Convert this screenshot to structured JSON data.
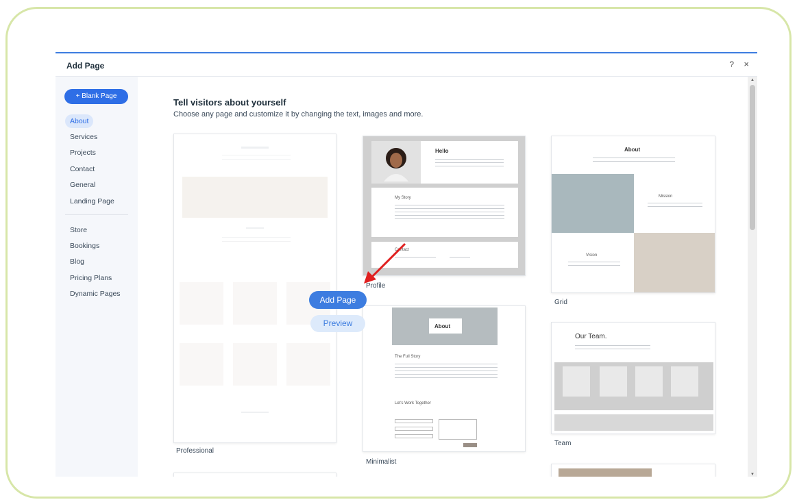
{
  "dialog": {
    "title": "Add Page",
    "help_label": "?",
    "close_label": "×"
  },
  "sidebar": {
    "blank_page_label": "+ Blank Page",
    "items_primary": [
      "About",
      "Services",
      "Projects",
      "Contact",
      "General",
      "Landing Page"
    ],
    "items_secondary": [
      "Store",
      "Bookings",
      "Blog",
      "Pricing Plans",
      "Dynamic Pages"
    ],
    "active_item": "About"
  },
  "main": {
    "heading": "Tell visitors about yourself",
    "subheading": "Choose any page and customize it by changing the text, images and more."
  },
  "templates": [
    {
      "name": "Professional"
    },
    {
      "name": "Profile",
      "title": "Hello",
      "sections": [
        "My Story",
        "Contact"
      ]
    },
    {
      "name": "Grid",
      "title": "About",
      "sections": [
        "Mission",
        "Vision"
      ]
    },
    {
      "name": "Minimalist",
      "title": "About",
      "sections": [
        "The Full Story",
        "Let's Work Together"
      ]
    },
    {
      "name": "Team",
      "title": "Our Team."
    }
  ],
  "hover_actions": {
    "add_page_label": "Add Page",
    "preview_label": "Preview"
  },
  "colors": {
    "accent": "#3d7de0",
    "frame": "#d7e6a8",
    "annotation_arrow": "#e02020"
  }
}
